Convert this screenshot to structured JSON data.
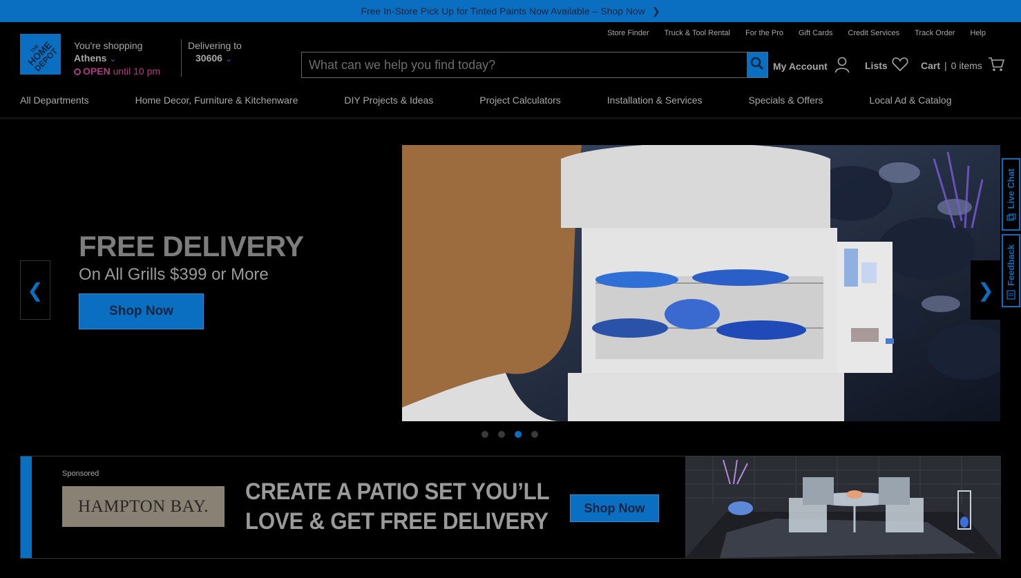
{
  "promo": {
    "text": "Free In-Store Pick Up for Tinted Paints Now Available – Shop Now"
  },
  "store": {
    "label": "You're shopping",
    "city": "Athens",
    "status": "OPEN",
    "hours": "until 10 pm"
  },
  "delivery": {
    "label": "Delivering to",
    "zip": "30606"
  },
  "utility_links": [
    "Store Finder",
    "Truck & Tool Rental",
    "For the Pro",
    "Gift Cards",
    "Credit Services",
    "Track Order",
    "Help"
  ],
  "search": {
    "placeholder": "What can we help you find today?"
  },
  "account": {
    "label": "My Account"
  },
  "lists": {
    "label": "Lists"
  },
  "cart": {
    "label": "Cart",
    "count": "0 items"
  },
  "nav": [
    "All Departments",
    "Home Decor, Furniture & Kitchenware",
    "DIY Projects & Ideas",
    "Project Calculators",
    "Installation & Services",
    "Specials & Offers",
    "Local Ad & Catalog"
  ],
  "hero": {
    "title": "FREE DELIVERY",
    "subtitle": "On All Grills $399 or More",
    "cta": "Shop Now",
    "slide_count": 4,
    "active_slide": 3
  },
  "side_tabs": {
    "live_chat": "Live Chat",
    "feedback": "Feedback"
  },
  "ad": {
    "sponsored": "Sponsored",
    "brand": "HAMPTON BAY.",
    "headline_line1": "CREATE A PATIO SET YOU’LL",
    "headline_line2": "LOVE & GET FREE DELIVERY",
    "cta": "Shop Now"
  },
  "colors": {
    "accent": "#0b6fc1",
    "open": "#b13a84",
    "background": "#000000"
  }
}
